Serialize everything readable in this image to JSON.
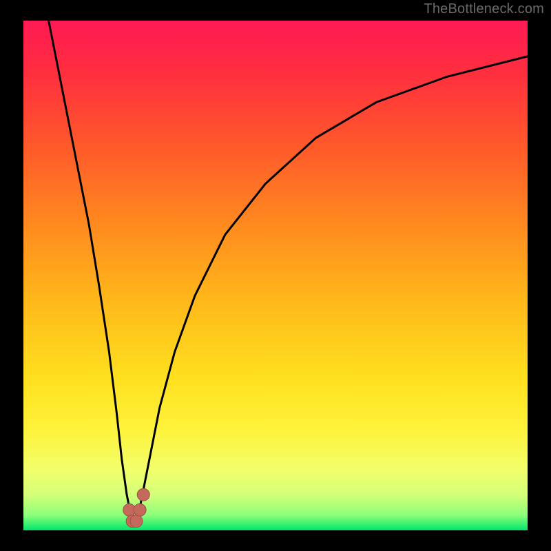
{
  "watermark": "TheBottleneck.com",
  "frame": {
    "outer_w": 800,
    "outer_h": 800,
    "inner_x": 34,
    "inner_y": 30,
    "inner_w": 732,
    "inner_h": 740
  },
  "colors": {
    "gradient_stops": [
      {
        "offset": 0.0,
        "color": "#ff1a54"
      },
      {
        "offset": 0.1,
        "color": "#ff2e3f"
      },
      {
        "offset": 0.25,
        "color": "#ff5a2a"
      },
      {
        "offset": 0.4,
        "color": "#ff8a1f"
      },
      {
        "offset": 0.55,
        "color": "#ffb81a"
      },
      {
        "offset": 0.7,
        "color": "#ffe01f"
      },
      {
        "offset": 0.8,
        "color": "#fff23a"
      },
      {
        "offset": 0.88,
        "color": "#f2ff6a"
      },
      {
        "offset": 0.93,
        "color": "#d4ff7a"
      },
      {
        "offset": 0.97,
        "color": "#8dff7a"
      },
      {
        "offset": 1.0,
        "color": "#00e66a"
      }
    ],
    "curve": "#000000",
    "marker_fill": "#c46a5d",
    "marker_stroke": "#a04e43"
  },
  "chart_data": {
    "type": "line",
    "title": "",
    "xlabel": "",
    "ylabel": "",
    "xlim": [
      0,
      100
    ],
    "ylim": [
      0,
      100
    ],
    "grid": false,
    "series": [
      {
        "name": "bottleneck-curve",
        "x": [
          5,
          7,
          9,
          11,
          13,
          15,
          17,
          18.5,
          19.5,
          20.5,
          21.3,
          22.0,
          22.8,
          23.6,
          25.0,
          27.0,
          30.0,
          34.0,
          40.0,
          48.0,
          58.0,
          70.0,
          84.0,
          100.0
        ],
        "y": [
          100,
          90,
          80,
          70,
          60,
          48,
          35,
          23,
          14,
          7,
          3,
          1.5,
          3,
          7,
          14,
          24,
          35,
          46,
          58,
          68,
          77,
          84,
          89,
          93
        ]
      }
    ],
    "markers": [
      {
        "name": "min-left",
        "x": 21.0,
        "y": 4.0
      },
      {
        "name": "min-mid-l",
        "x": 21.6,
        "y": 1.8
      },
      {
        "name": "min-mid-r",
        "x": 22.4,
        "y": 1.8
      },
      {
        "name": "min-right",
        "x": 23.1,
        "y": 4.0
      },
      {
        "name": "min-upper",
        "x": 23.8,
        "y": 7.0
      }
    ]
  }
}
